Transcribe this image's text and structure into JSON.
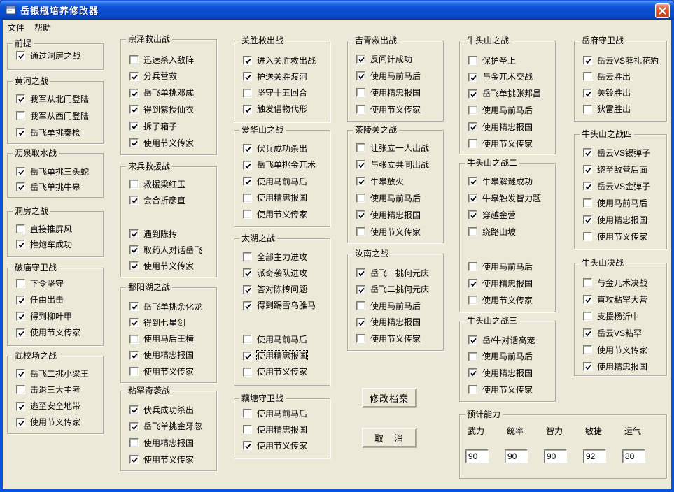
{
  "window": {
    "title": "岳银瓶培养修改器"
  },
  "menu": {
    "items": [
      {
        "label": "文件"
      },
      {
        "label": "帮助"
      }
    ]
  },
  "groups": [
    {
      "title": "前提",
      "items": [
        {
          "label": "通过洞房之战",
          "checked": true
        }
      ]
    },
    {
      "title": "黄河之战",
      "items": [
        {
          "label": "我军从北门登陆",
          "checked": true
        },
        {
          "label": "我军从西门登陆",
          "checked": false
        },
        {
          "label": "岳飞单挑秦桧",
          "checked": true
        }
      ]
    },
    {
      "title": "沥泉取水战",
      "items": [
        {
          "label": "岳飞单挑三头蛇",
          "checked": true
        },
        {
          "label": "岳飞单挑牛皋",
          "checked": true
        }
      ]
    },
    {
      "title": "洞房之战",
      "items": [
        {
          "label": "直接推屏风",
          "checked": false
        },
        {
          "label": "推炮车成功",
          "checked": true
        }
      ]
    },
    {
      "title": "破庙守卫战",
      "items": [
        {
          "label": "下令坚守",
          "checked": false
        },
        {
          "label": "任由出击",
          "checked": true
        },
        {
          "label": "得到柳叶甲",
          "checked": true
        },
        {
          "label": "使用节义传家",
          "checked": true
        }
      ]
    },
    {
      "title": "武校场之战",
      "items": [
        {
          "label": "岳飞二挑小梁王",
          "checked": true
        },
        {
          "label": "击退三大主考",
          "checked": false
        },
        {
          "label": "逃至安全地带",
          "checked": true
        },
        {
          "label": "使用节义传家",
          "checked": true
        }
      ]
    },
    {
      "title": "宗泽救出战",
      "items": [
        {
          "label": "迅速杀入敌阵",
          "checked": false
        },
        {
          "label": "分兵营救",
          "checked": true
        },
        {
          "label": "岳飞单挑邓成",
          "checked": true
        },
        {
          "label": "得到紫授仙衣",
          "checked": true
        },
        {
          "label": "拆了箱子",
          "checked": true
        },
        {
          "label": "使用节义传家",
          "checked": true
        }
      ]
    },
    {
      "title": "宋兵救援战",
      "items": [
        {
          "label": "救援梁红玉",
          "checked": false
        },
        {
          "label": "会合折彦直",
          "checked": true
        },
        {
          "label": "遇到陈抟",
          "checked": true,
          "gap": true
        },
        {
          "label": "取药人对话岳飞",
          "checked": true
        },
        {
          "label": "使用节义传家",
          "checked": true
        }
      ]
    },
    {
      "title": "鄱阳湖之战",
      "items": [
        {
          "label": "岳飞单挑余化龙",
          "checked": true
        },
        {
          "label": "得到七星剑",
          "checked": true
        },
        {
          "label": "使用马后王横",
          "checked": false
        },
        {
          "label": "使用精忠报国",
          "checked": true
        },
        {
          "label": "使用节义传家",
          "checked": false
        }
      ]
    },
    {
      "title": "粘罕奇袭战",
      "items": [
        {
          "label": "伏兵成功杀出",
          "checked": true
        },
        {
          "label": "岳飞单挑金牙忽",
          "checked": true
        },
        {
          "label": "使用精忠报国",
          "checked": false
        },
        {
          "label": "使用节义传家",
          "checked": true
        }
      ]
    },
    {
      "title": "关胜救出战",
      "items": [
        {
          "label": "进入关胜救出战",
          "checked": true
        },
        {
          "label": "护送关胜渡河",
          "checked": true
        },
        {
          "label": "坚守十五回合",
          "checked": false
        },
        {
          "label": "触发借物代形",
          "checked": true
        }
      ]
    },
    {
      "title": "爱华山之战",
      "items": [
        {
          "label": "伏兵成功杀出",
          "checked": true
        },
        {
          "label": "岳飞单挑金兀术",
          "checked": true
        },
        {
          "label": "使用马前马后",
          "checked": true
        },
        {
          "label": "使用精忠报国",
          "checked": false
        },
        {
          "label": "使用节义传家",
          "checked": false
        }
      ]
    },
    {
      "title": "太湖之战",
      "items": [
        {
          "label": "全部主力进攻",
          "checked": false
        },
        {
          "label": "派奇袭队进攻",
          "checked": true
        },
        {
          "label": "答对陈抟问题",
          "checked": true
        },
        {
          "label": "得到踢雪乌骓马",
          "checked": true
        },
        {
          "label": "使用马前马后",
          "checked": false,
          "gap": true
        },
        {
          "label": "使用精忠报国",
          "checked": true,
          "focused": true
        },
        {
          "label": "使用节义传家",
          "checked": false
        }
      ]
    },
    {
      "title": "藕塘守卫战",
      "items": [
        {
          "label": "使用马前马后",
          "checked": false
        },
        {
          "label": "使用精忠报国",
          "checked": false
        },
        {
          "label": "使用节义传家",
          "checked": true
        }
      ]
    },
    {
      "title": "吉青救出战",
      "items": [
        {
          "label": "反间计成功",
          "checked": true
        },
        {
          "label": "使用马前马后",
          "checked": true
        },
        {
          "label": "使用精忠报国",
          "checked": false
        },
        {
          "label": "使用节义传家",
          "checked": false
        }
      ]
    },
    {
      "title": "茶陵关之战",
      "items": [
        {
          "label": "让张立一人出战",
          "checked": false
        },
        {
          "label": "与张立共同出战",
          "checked": true
        },
        {
          "label": "牛皋放火",
          "checked": true
        },
        {
          "label": "使用马前马后",
          "checked": false
        },
        {
          "label": "使用精忠报国",
          "checked": true
        },
        {
          "label": "使用节义传家",
          "checked": false
        }
      ]
    },
    {
      "title": "汝南之战",
      "items": [
        {
          "label": "岳飞一挑何元庆",
          "checked": true
        },
        {
          "label": "岳飞二挑何元庆",
          "checked": true
        },
        {
          "label": "使用马前马后",
          "checked": false
        },
        {
          "label": "使用精忠报国",
          "checked": true
        },
        {
          "label": "使用节义传家",
          "checked": false
        }
      ]
    },
    {
      "title": "牛头山之战",
      "items": [
        {
          "label": "保护圣上",
          "checked": false
        },
        {
          "label": "与金兀术交战",
          "checked": true
        },
        {
          "label": "岳飞单挑张邦昌",
          "checked": true
        },
        {
          "label": "使用马前马后",
          "checked": false
        },
        {
          "label": "使用精忠报国",
          "checked": true
        },
        {
          "label": "使用节义传家",
          "checked": false
        }
      ]
    },
    {
      "title": "牛头山之战二",
      "items": [
        {
          "label": "牛皋解谜成功",
          "checked": true
        },
        {
          "label": "牛皋触发智力题",
          "checked": true
        },
        {
          "label": "穿越金营",
          "checked": true
        },
        {
          "label": "绕路山坡",
          "checked": false
        },
        {
          "label": "使用马前马后",
          "checked": false,
          "gap": true
        },
        {
          "label": "使用精忠报国",
          "checked": true
        },
        {
          "label": "使用节义传家",
          "checked": false
        }
      ]
    },
    {
      "title": "牛头山之战三",
      "items": [
        {
          "label": "岳/牛对话高宠",
          "checked": true
        },
        {
          "label": "使用马前马后",
          "checked": false
        },
        {
          "label": "使用精忠报国",
          "checked": true
        },
        {
          "label": "使用节义传家",
          "checked": false
        }
      ]
    },
    {
      "title": "岳府守卫战",
      "items": [
        {
          "label": "岳云VS薛礼花豹",
          "checked": true
        },
        {
          "label": "岳云胜出",
          "checked": false
        },
        {
          "label": "关铃胜出",
          "checked": true
        },
        {
          "label": "狄雷胜出",
          "checked": false
        }
      ]
    },
    {
      "title": "牛头山之战四",
      "items": [
        {
          "label": "岳云VS银弹子",
          "checked": true
        },
        {
          "label": "绕至敌营后面",
          "checked": true
        },
        {
          "label": "岳云VS金弹子",
          "checked": true
        },
        {
          "label": "使用马前马后",
          "checked": false
        },
        {
          "label": "使用精忠报国",
          "checked": true
        },
        {
          "label": "使用节义传家",
          "checked": false
        }
      ]
    },
    {
      "title": "牛头山决战",
      "items": [
        {
          "label": "与金兀术决战",
          "checked": false
        },
        {
          "label": "直攻粘罕大营",
          "checked": true
        },
        {
          "label": "支援杨沂中",
          "checked": false
        },
        {
          "label": "岳云VS粘罕",
          "checked": true
        },
        {
          "label": "使用节义传家",
          "checked": false
        },
        {
          "label": "使用精忠报国",
          "checked": true
        }
      ]
    }
  ],
  "buttons": {
    "modify": {
      "label": "修改档案"
    },
    "cancel": {
      "label": "取　消"
    }
  },
  "ability": {
    "title": "预计能力",
    "stats": [
      {
        "label": "武力",
        "value": "90"
      },
      {
        "label": "统率",
        "value": "90"
      },
      {
        "label": "智力",
        "value": "90"
      },
      {
        "label": "敏捷",
        "value": "92"
      },
      {
        "label": "运气",
        "value": "80"
      }
    ]
  }
}
